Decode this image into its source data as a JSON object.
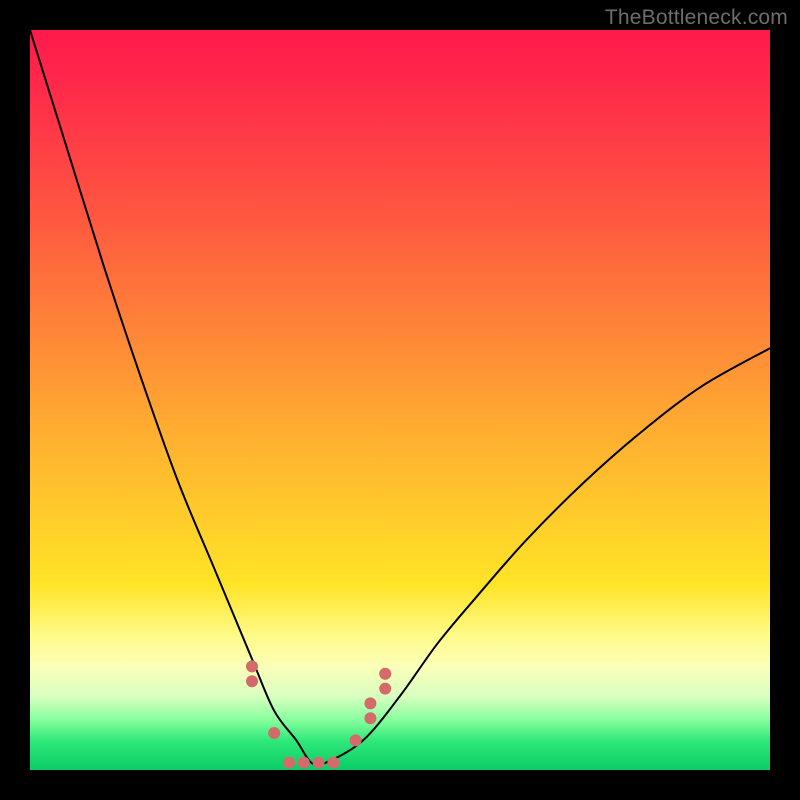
{
  "watermark": "TheBottleneck.com",
  "colors": {
    "frame": "#000000",
    "curve": "#000000",
    "dots": "#d46a6a",
    "watermark": "#6d6d6d"
  },
  "chart_data": {
    "type": "line",
    "title": "",
    "xlabel": "",
    "ylabel": "",
    "xlim": [
      0,
      100
    ],
    "ylim": [
      0,
      100
    ],
    "grid": false,
    "series": [
      {
        "name": "bottleneck-curve",
        "x": [
          0,
          5,
          10,
          15,
          20,
          25,
          30,
          33,
          36,
          38,
          40,
          45,
          50,
          55,
          60,
          67,
          75,
          83,
          91,
          100
        ],
        "values": [
          100,
          84,
          68,
          53,
          39,
          27,
          15,
          8,
          4,
          1,
          1,
          4,
          10,
          17,
          23,
          31,
          39,
          46,
          52,
          57
        ]
      }
    ],
    "annotations": [
      {
        "name": "min-cluster-dots",
        "color": "#d46a6a",
        "points_xy": [
          [
            30,
            14
          ],
          [
            30,
            12
          ],
          [
            33,
            5
          ],
          [
            35,
            1
          ],
          [
            37,
            1
          ],
          [
            39,
            1
          ],
          [
            41,
            1
          ],
          [
            44,
            4
          ],
          [
            46,
            7
          ],
          [
            46,
            9
          ],
          [
            48,
            11
          ],
          [
            48,
            13
          ]
        ]
      }
    ]
  }
}
